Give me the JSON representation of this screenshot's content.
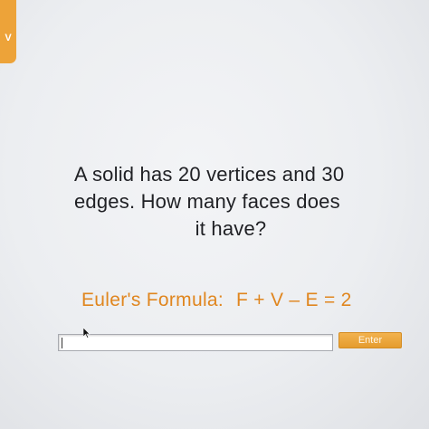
{
  "corner_tab": {
    "label": "V"
  },
  "question": {
    "line1": "A solid has 20 vertices and 30",
    "line2": "edges.  How many faces does",
    "line3": "it have?"
  },
  "formula": {
    "label": "Euler's Formula:",
    "expression": "F + V – E = 2"
  },
  "answer": {
    "value": "",
    "placeholder": ""
  },
  "enter_button": {
    "label": "Enter"
  },
  "colors": {
    "accent": "#eda339",
    "formula_text": "#e0861f",
    "question_text": "#1f2024"
  },
  "icons": {
    "pointer": "mouse-pointer-icon"
  }
}
